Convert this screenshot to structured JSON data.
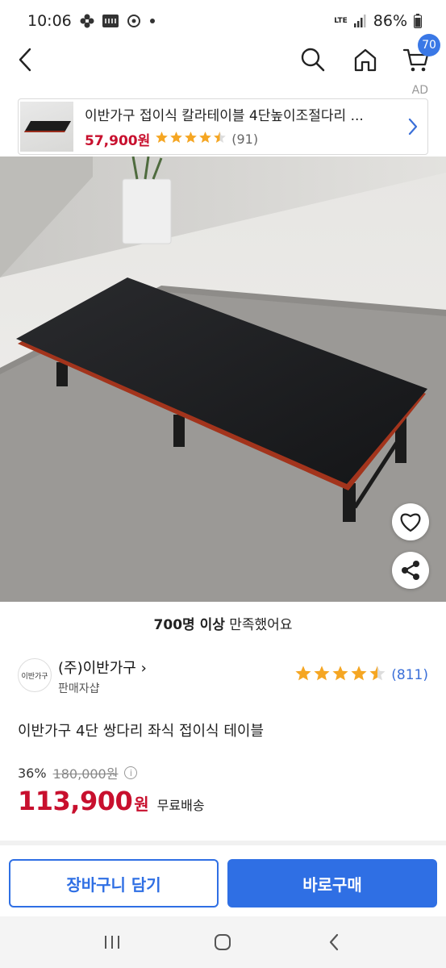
{
  "status_bar": {
    "time": "10:06",
    "network": "LTE",
    "battery": "86%"
  },
  "nav": {
    "cart_count": "70"
  },
  "ad": {
    "label": "AD",
    "title": "이반가구 접이식 칼라테이블 4단높이조절다리 ...",
    "price": "57,900원",
    "rating": 4.5,
    "reviews": "(91)"
  },
  "product": {
    "satisfied_bold": "700명 이상",
    "satisfied_rest": " 만족했어요",
    "seller_logo_text": "이반가구",
    "seller_name": "(주)이반가구",
    "seller_chevron": "›",
    "seller_sub": "판매자샵",
    "rating": 4.5,
    "reviews": "(811)",
    "title": "이반가구 4단 쌍다리 좌식 접이식 테이블",
    "discount": "36%",
    "original_price": "180,000원",
    "info_symbol": "i",
    "sale_price": "113,900",
    "sale_unit": "원",
    "shipping": "무료배송"
  },
  "actions": {
    "cart": "장바구니 담기",
    "buy": "바로구매"
  },
  "colors": {
    "accent": "#2f6fe4",
    "price_red": "#c8102e",
    "star": "#f5a623",
    "badge": "#3a78e6"
  }
}
